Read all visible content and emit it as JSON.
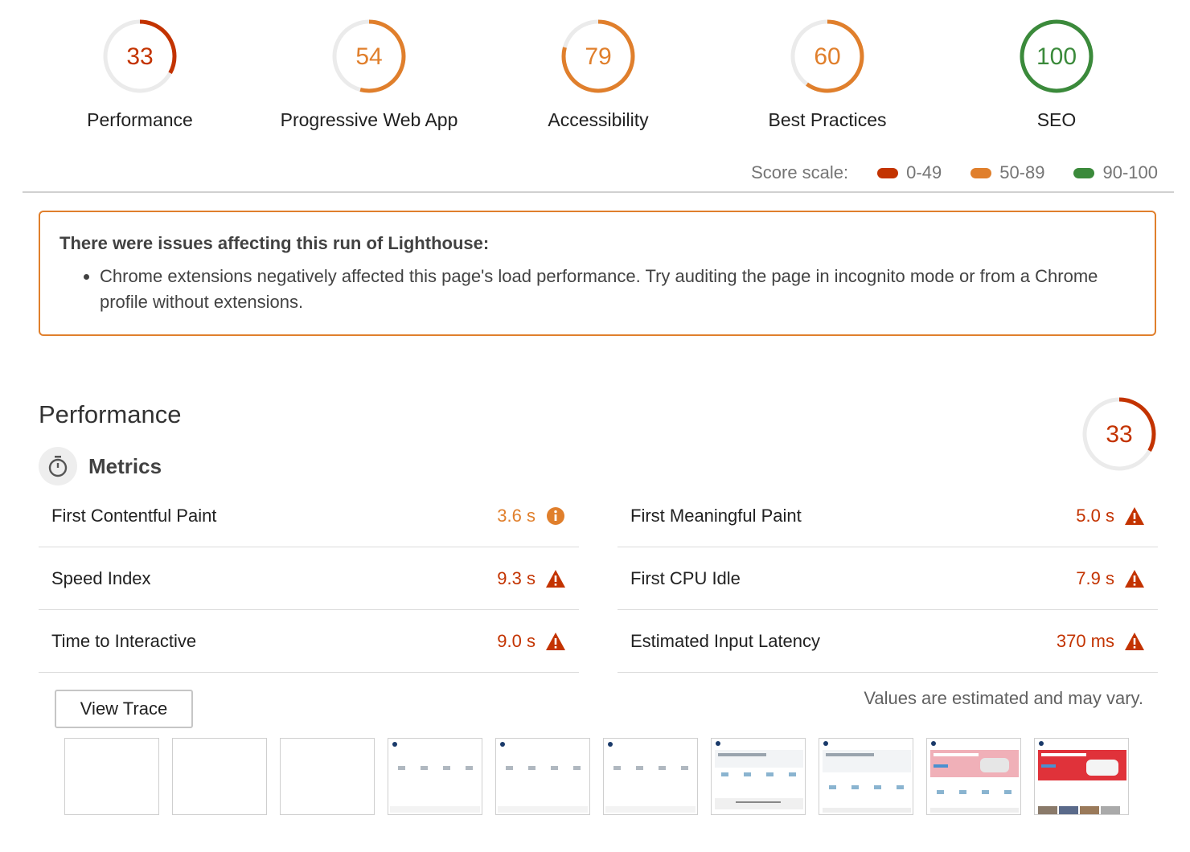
{
  "gauges": [
    {
      "score": "33",
      "value": 33,
      "label": "Performance",
      "color": "#c33300"
    },
    {
      "score": "54",
      "value": 54,
      "label": "Progressive Web App",
      "color": "#e07f2c"
    },
    {
      "score": "79",
      "value": 79,
      "label": "Accessibility",
      "color": "#e07f2c"
    },
    {
      "score": "60",
      "value": 60,
      "label": "Best Practices",
      "color": "#e07f2c"
    },
    {
      "score": "100",
      "value": 100,
      "label": "SEO",
      "color": "#3b8a3b"
    }
  ],
  "score_scale": {
    "label": "Score scale:",
    "ranges": [
      {
        "label": "0-49",
        "color": "#c33300"
      },
      {
        "label": "50-89",
        "color": "#e07f2c"
      },
      {
        "label": "90-100",
        "color": "#3b8a3b"
      }
    ]
  },
  "warning": {
    "title": "There were issues affecting this run of Lighthouse:",
    "items": [
      "Chrome extensions negatively affected this page's load performance. Try auditing the page in incognito mode or from a Chrome profile without extensions."
    ]
  },
  "performance": {
    "title": "Performance",
    "score": "33",
    "value": 33,
    "metrics_title": "Metrics",
    "metrics": [
      {
        "name": "First Contentful Paint",
        "value": "3.6 s",
        "status": "average",
        "icon": "info-icon"
      },
      {
        "name": "First Meaningful Paint",
        "value": "5.0 s",
        "status": "fail",
        "icon": "warning-icon"
      },
      {
        "name": "Speed Index",
        "value": "9.3 s",
        "status": "fail",
        "icon": "warning-icon"
      },
      {
        "name": "First CPU Idle",
        "value": "7.9 s",
        "status": "fail",
        "icon": "warning-icon"
      },
      {
        "name": "Time to Interactive",
        "value": "9.0 s",
        "status": "fail",
        "icon": "warning-icon"
      },
      {
        "name": "Estimated Input Latency",
        "value": "370 ms",
        "status": "fail",
        "icon": "warning-icon"
      }
    ],
    "view_trace_label": "View Trace",
    "estimate_note": "Values are estimated and may vary.",
    "filmstrip_frames": [
      "blank",
      "blank",
      "blank",
      "icons",
      "icons",
      "icons",
      "banner-outline",
      "banner-outline",
      "banner-pink",
      "banner-red"
    ]
  },
  "colors": {
    "fail": "#c33300",
    "average": "#e07f2c",
    "pass": "#3b8a3b"
  }
}
